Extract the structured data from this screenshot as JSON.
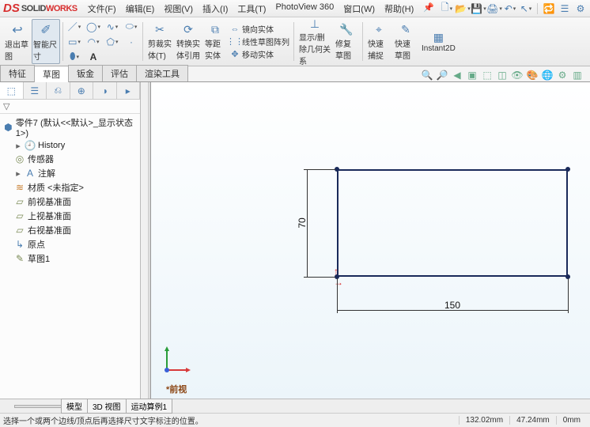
{
  "logo": {
    "solid": "SOLID",
    "works": "WORKS"
  },
  "menu": [
    "文件(F)",
    "编辑(E)",
    "视图(V)",
    "插入(I)",
    "工具(T)",
    "PhotoView 360",
    "窗口(W)",
    "帮助(H)"
  ],
  "ribbon": {
    "exit_sketch": "退出草图",
    "smart_dim": "智能尺寸",
    "trim": "剪裁实体(T)",
    "convert": "转换实体引用",
    "offset": "等距实体",
    "mirror": "镜向实体",
    "linear_pattern": "线性草图阵列",
    "move": "移动实体",
    "display_delete": "显示/删除几何关系",
    "repair": "修复草图",
    "quick_snap": "快速捕捉",
    "rapid_sketch": "快速草图",
    "instant2d": "Instant2D"
  },
  "tabs": [
    "特征",
    "草图",
    "钣金",
    "评估",
    "渲染工具"
  ],
  "active_tab": "草图",
  "tree": {
    "root": "零件7 (默认<<默认>_显示状态 1>)",
    "history": "History",
    "sensors": "传感器",
    "annotations": "注解",
    "material": "材质 <未指定>",
    "front": "前视基准面",
    "top": "上视基准面",
    "right": "右视基准面",
    "origin": "原点",
    "sketch1": "草图1"
  },
  "dims": {
    "w": "150",
    "h": "70"
  },
  "view_label": "*前视",
  "btm_tabs": [
    "模型",
    "3D 视图",
    "运动算例1"
  ],
  "status_text": "选择一个或两个边线/顶点后再选择尺寸文字标注的位置。",
  "status_coords": {
    "x": "132.02mm",
    "y": "47.24mm",
    "z": "0mm"
  }
}
